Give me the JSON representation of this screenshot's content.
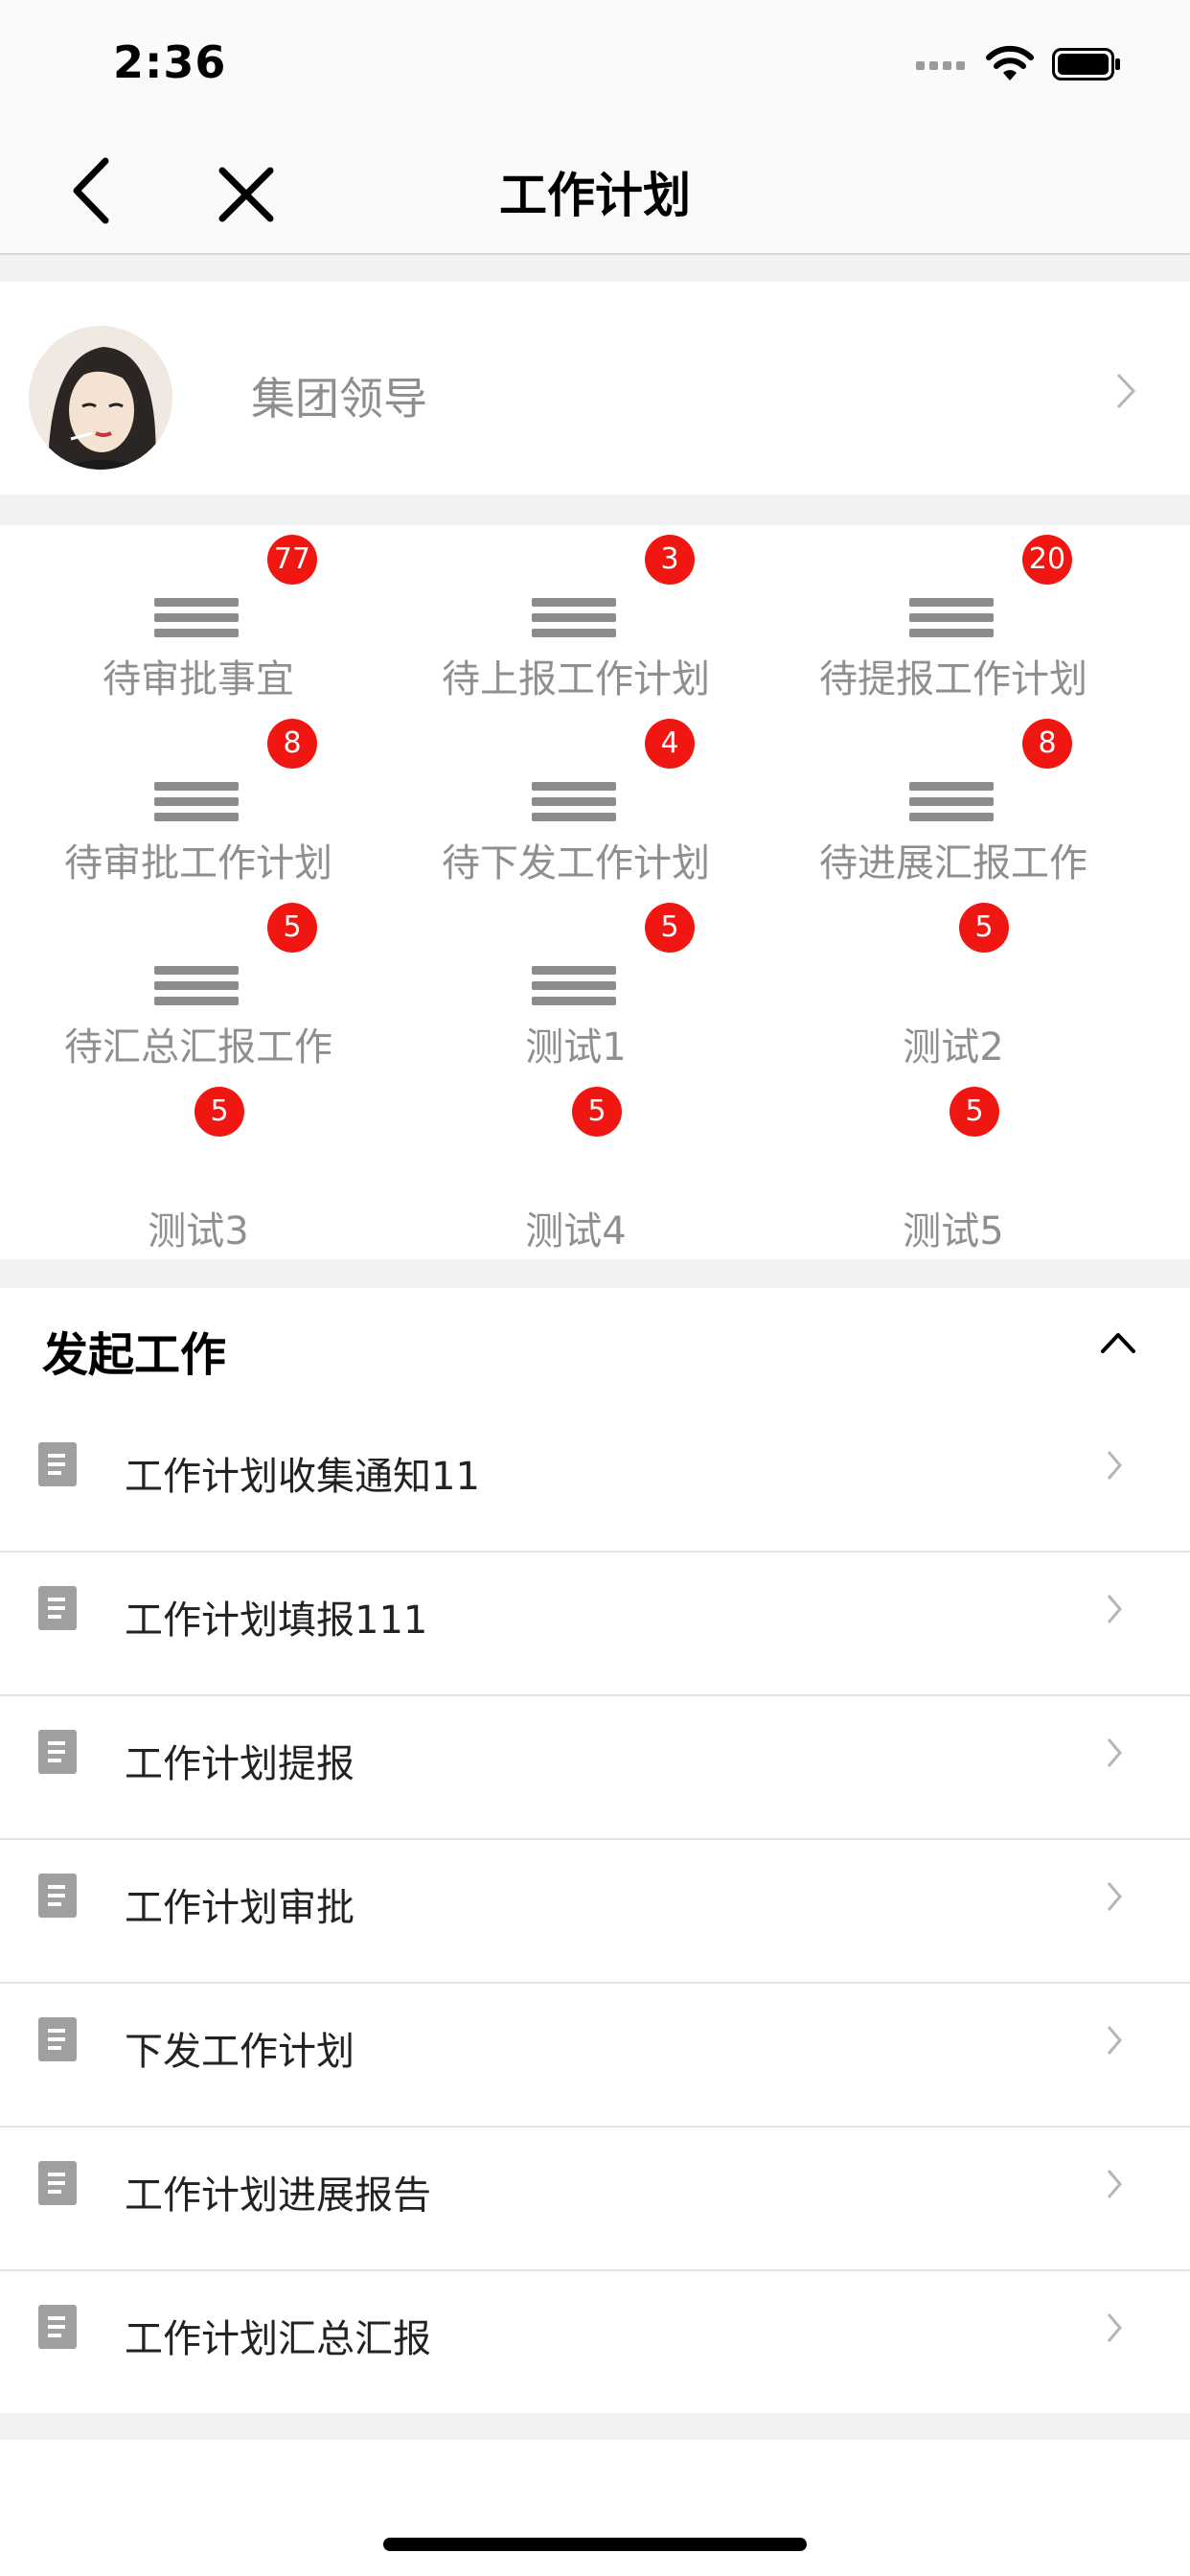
{
  "status_bar": {
    "time": "2:36"
  },
  "nav": {
    "title": "工作计划"
  },
  "profile": {
    "name": "集团领导"
  },
  "shortcuts": [
    {
      "label": "待审批事宜",
      "badge": "77",
      "icon": "list-icon"
    },
    {
      "label": "待上报工作计划",
      "badge": "3",
      "icon": "list-icon"
    },
    {
      "label": "待提报工作计划",
      "badge": "20",
      "icon": "list-icon"
    },
    {
      "label": "待审批工作计划",
      "badge": "8",
      "icon": "list-icon"
    },
    {
      "label": "待下发工作计划",
      "badge": "4",
      "icon": "list-icon"
    },
    {
      "label": "待进展汇报工作",
      "badge": "8",
      "icon": "list-icon"
    },
    {
      "label": "待汇总汇报工作",
      "badge": "5",
      "icon": "list-icon"
    },
    {
      "label": "测试1",
      "badge": "5",
      "icon": "list-icon"
    },
    {
      "label": "测试2",
      "badge": "5",
      "icon": ""
    },
    {
      "label": "测试3",
      "badge": "5",
      "icon": ""
    },
    {
      "label": "测试4",
      "badge": "5",
      "icon": ""
    },
    {
      "label": "测试5",
      "badge": "5",
      "icon": ""
    }
  ],
  "section": {
    "title": "发起工作",
    "items": [
      {
        "label": "工作计划收集通知11"
      },
      {
        "label": "工作计划填报111"
      },
      {
        "label": "工作计划提报"
      },
      {
        "label": "工作计划审批"
      },
      {
        "label": "下发工作计划"
      },
      {
        "label": "工作计划进展报告"
      },
      {
        "label": "工作计划汇总汇报"
      }
    ]
  },
  "colors": {
    "badge": "#f01611",
    "background": "#f2f2f2",
    "muted_text": "#8f8f8f"
  }
}
